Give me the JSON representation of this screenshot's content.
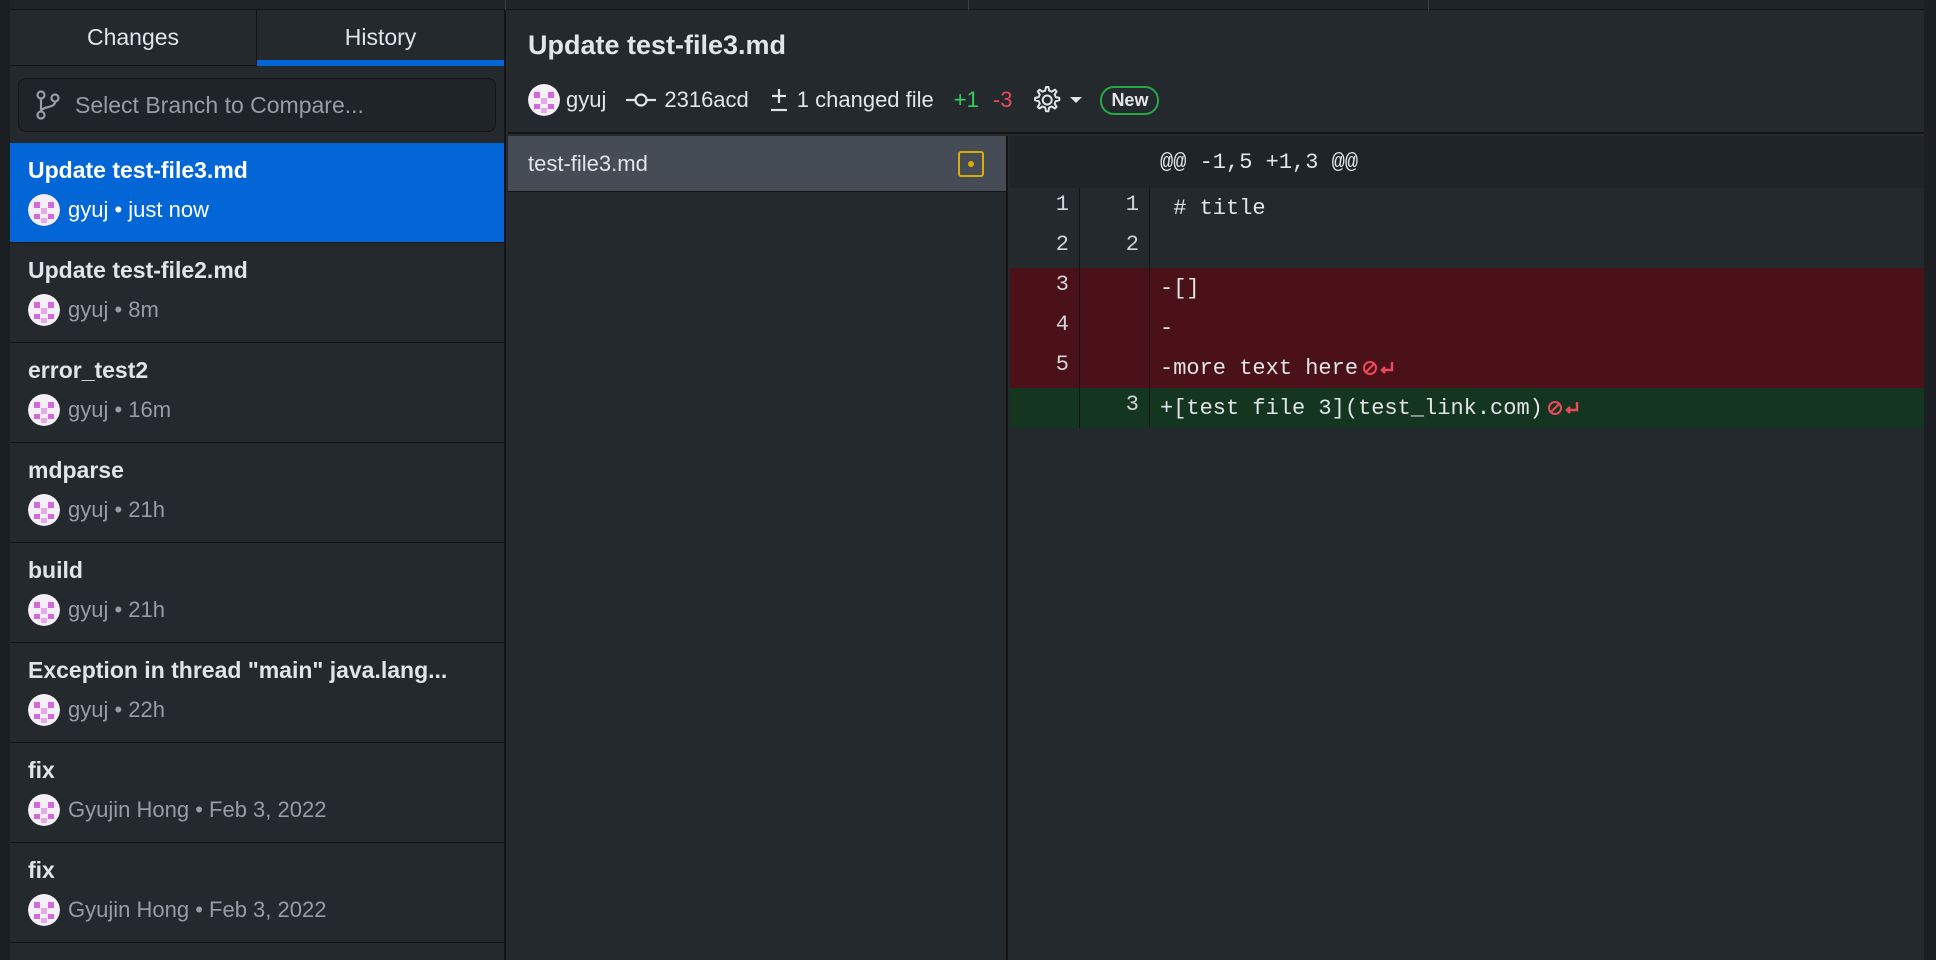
{
  "tabs": [
    {
      "label": "Changes",
      "active": false
    },
    {
      "label": "History",
      "active": true
    }
  ],
  "branch_compare": {
    "placeholder": "Select Branch to Compare...",
    "icon": "git-branch-icon"
  },
  "commits": [
    {
      "title": "Update test-file3.md",
      "author": "gyuj",
      "time": "just now",
      "selected": true
    },
    {
      "title": "Update test-file2.md",
      "author": "gyuj",
      "time": "8m"
    },
    {
      "title": "error_test2",
      "author": "gyuj",
      "time": "16m"
    },
    {
      "title": "mdparse",
      "author": "gyuj",
      "time": "21h"
    },
    {
      "title": "build",
      "author": "gyuj",
      "time": "21h"
    },
    {
      "title": "Exception in thread \"main\" java.lang...",
      "author": "gyuj",
      "time": "22h"
    },
    {
      "title": "fix",
      "author": "Gyujin Hong",
      "time": "Feb 3, 2022"
    },
    {
      "title": "fix",
      "author": "Gyujin Hong",
      "time": "Feb 3, 2022"
    }
  ],
  "commit_header": {
    "title": "Update test-file3.md",
    "author": "gyuj",
    "sha": "2316acd",
    "changed_files": "1 changed file",
    "additions": "+1",
    "deletions": "-3",
    "badge": "New"
  },
  "files": [
    {
      "name": "test-file3.md",
      "status_icon": "file-modified-icon"
    }
  ],
  "diff": {
    "hunk_header": "@@ -1,5 +1,3 @@",
    "lines": [
      {
        "type": "ctx",
        "old": "1",
        "new": "1",
        "text": " # title"
      },
      {
        "type": "ctx",
        "old": "2",
        "new": "2",
        "text": ""
      },
      {
        "type": "del",
        "old": "3",
        "new": "",
        "text": "-[]"
      },
      {
        "type": "del",
        "old": "4",
        "new": "",
        "text": "-"
      },
      {
        "type": "del",
        "old": "5",
        "new": "",
        "text": "-more text here",
        "no_newline": true
      },
      {
        "type": "add",
        "old": "",
        "new": "3",
        "text": "+[test file 3](test_link.com)",
        "no_newline": true
      }
    ]
  },
  "colors": {
    "accent": "#0366d6",
    "added": "#34d058",
    "removed": "#ea4a5a",
    "modified": "#dbab09"
  }
}
